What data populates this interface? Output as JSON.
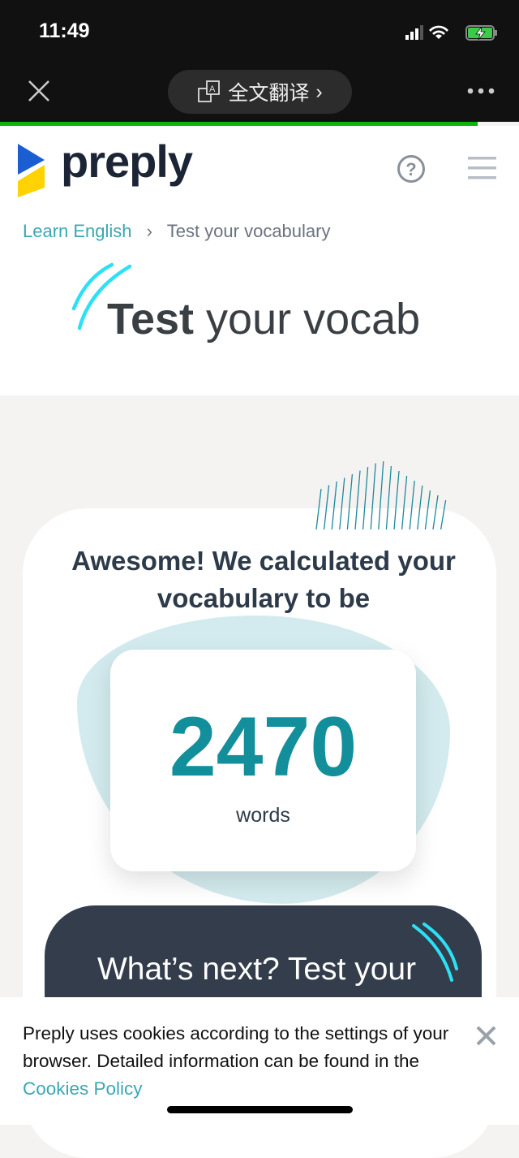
{
  "status_bar": {
    "time": "11:49"
  },
  "browser": {
    "translate_label": "全文翻译",
    "chevron": "›"
  },
  "header": {
    "logo_text": "preply"
  },
  "breadcrumb": {
    "parent": "Learn English",
    "separator": "›",
    "current": "Test your vocabulary"
  },
  "title": {
    "bold": "Test",
    "rest": " your vocab"
  },
  "result": {
    "heading": "Awesome! We calculated your vocabulary to be",
    "score": "2470",
    "unit": "words"
  },
  "next": {
    "text": "What’s next? Test your"
  },
  "cookie": {
    "text": "Preply uses cookies according to the settings of your browser. Detailed information can be found in the ",
    "link": "Cookies Policy"
  },
  "colors": {
    "accent": "#138f9c",
    "progress": "#0cb30c",
    "dark": "#333d4c"
  }
}
